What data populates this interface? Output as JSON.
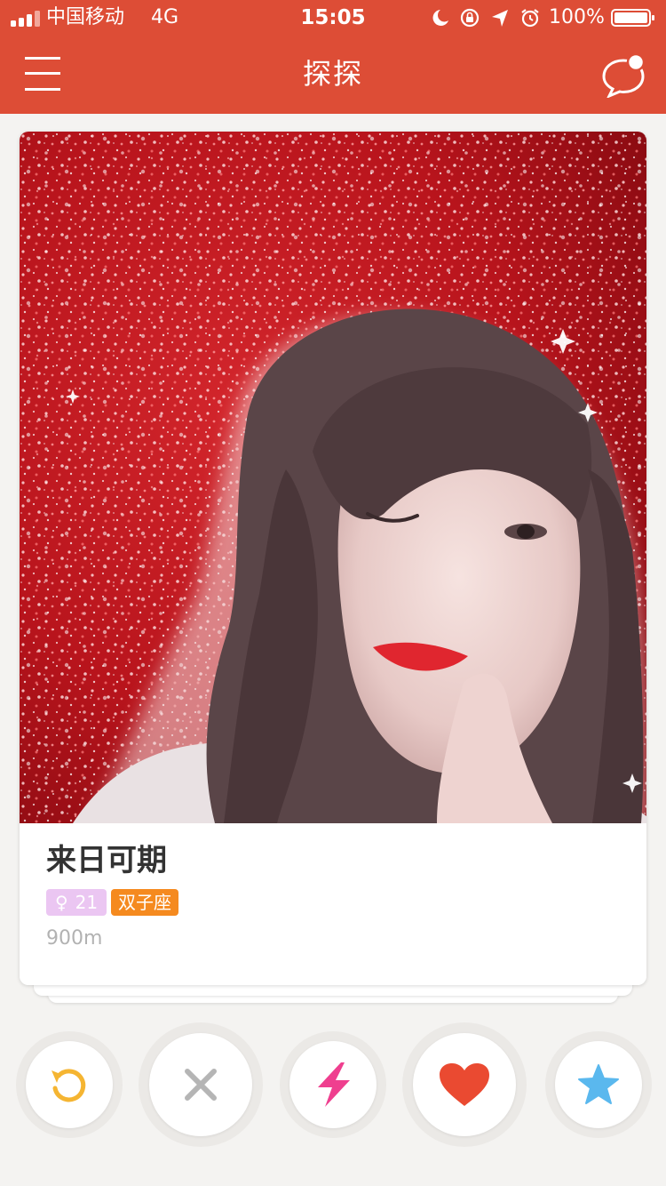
{
  "status_bar": {
    "carrier": "中国移动",
    "network": "4G",
    "time": "15:05",
    "battery": "100%"
  },
  "header": {
    "title": "探探",
    "menu_icon": "hamburger-menu-icon",
    "chat_icon": "chat-bubble-icon",
    "background_color": "#dd4d36"
  },
  "card": {
    "photo_icon": "profile-photo",
    "name": "来日可期",
    "gender_symbol": "♀",
    "age": "21",
    "zodiac": "双子座",
    "distance": "900m",
    "colors": {
      "gender_badge": "#ebc6f2",
      "zodiac_badge": "#f58a1f"
    }
  },
  "actions": [
    {
      "name": "undo",
      "icon": "undo-icon",
      "color": "#f5b532"
    },
    {
      "name": "nope",
      "icon": "close-icon",
      "color": "#b5b5b5"
    },
    {
      "name": "boost",
      "icon": "lightning-icon",
      "color": "#ef3f8f"
    },
    {
      "name": "like",
      "icon": "heart-icon",
      "color": "#ea4a31"
    },
    {
      "name": "super-like",
      "icon": "star-icon",
      "color": "#5ab8ee"
    }
  ]
}
